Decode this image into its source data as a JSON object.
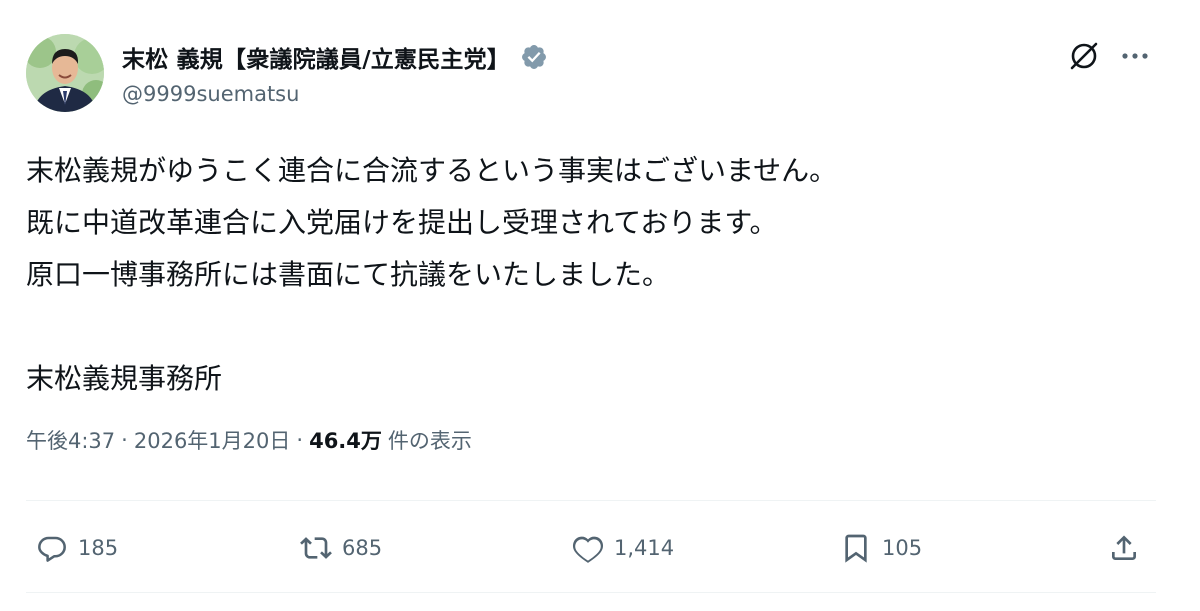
{
  "author": {
    "display_name": "末松 義規【衆議院議員/立憲民主党】",
    "handle": "@9999suematsu",
    "verified_color": "#829aab"
  },
  "tweet": {
    "lines": [
      "末松義規がゆうこく連合に合流するという事実はございません。",
      "既に中道改革連合に入党届けを提出し受理されております。",
      "原口一博事務所には書面にて抗議をいたしました。",
      "",
      "末松義規事務所"
    ]
  },
  "meta": {
    "time": "午後4:37",
    "separator": "·",
    "date": "2026年1月20日",
    "views_count": "46.4万",
    "views_label": "件の表示"
  },
  "actions": {
    "replies": "185",
    "reposts": "685",
    "likes": "1,414",
    "bookmarks": "105"
  },
  "icons": {
    "header": [
      "grok-icon",
      "more-icon"
    ],
    "actions": [
      "reply-icon",
      "repost-icon",
      "like-icon",
      "bookmark-icon",
      "share-icon"
    ]
  },
  "colors": {
    "text": "#0f1419",
    "secondary": "#536471",
    "divider": "#eff3f4"
  }
}
